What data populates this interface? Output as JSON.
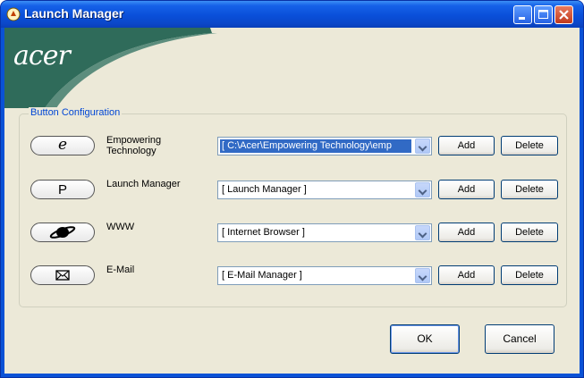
{
  "window": {
    "title": "Launch Manager",
    "brand": "acer",
    "colors": {
      "titlebar": "#0a4fd9",
      "face": "#ece9d8",
      "banner": "#2f6b5a",
      "group_label": "#0046d5"
    }
  },
  "group": {
    "label": "Button Configuration",
    "rows": [
      {
        "icon": "e-icon",
        "glyph": "e",
        "label": "Empowering Technology",
        "value": "[ C:\\Acer\\Empowering Technology\\emp",
        "selected": true,
        "add": "Add",
        "delete": "Delete"
      },
      {
        "icon": "p-icon",
        "glyph": "P",
        "label": "Launch Manager",
        "value": "[ Launch Manager ]",
        "selected": false,
        "add": "Add",
        "delete": "Delete"
      },
      {
        "icon": "planet-icon",
        "glyph": "🪐",
        "label": "WWW",
        "value": "[ Internet Browser ]",
        "selected": false,
        "add": "Add",
        "delete": "Delete"
      },
      {
        "icon": "envelope-icon",
        "glyph": "✉",
        "label": "E-Mail",
        "value": "[ E-Mail Manager ]",
        "selected": false,
        "add": "Add",
        "delete": "Delete"
      }
    ]
  },
  "footer": {
    "ok": "OK",
    "cancel": "Cancel"
  }
}
